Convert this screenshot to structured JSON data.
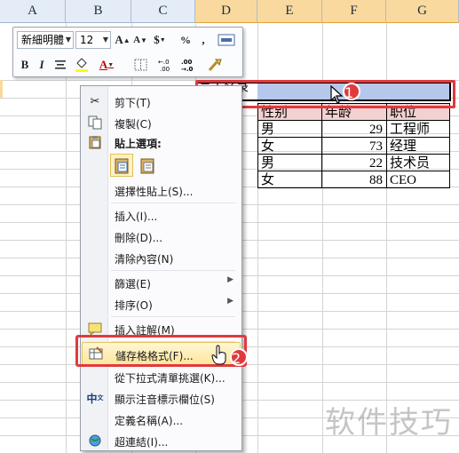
{
  "columns": [
    "A",
    "B",
    "C",
    "D",
    "E",
    "F",
    "G"
  ],
  "mini_toolbar": {
    "font_name": "新細明體",
    "font_size": "12",
    "grow_label": "A",
    "shrink_label": "A",
    "currency_label": "$",
    "percent_label": "%",
    "comma_label": ",",
    "bold_label": "B",
    "italic_label": "I",
    "font_color_label": "A"
  },
  "table": {
    "title": "员工名录",
    "headers": [
      "性别",
      "年龄",
      "职位"
    ],
    "rows": [
      {
        "gender": "男",
        "age": "29",
        "position": "工程师"
      },
      {
        "gender": "女",
        "age": "73",
        "position": "经理"
      },
      {
        "gender": "男",
        "age": "22",
        "position": "技术员"
      },
      {
        "gender": "女",
        "age": "88",
        "position": "CEO"
      }
    ]
  },
  "context_menu": {
    "cut": "剪下(T)",
    "copy": "複製(C)",
    "paste_options": "貼上選項:",
    "paste_special": "選擇性貼上(S)...",
    "insert": "插入(I)...",
    "delete": "刪除(D)...",
    "clear": "清除內容(N)",
    "filter": "篩選(E)",
    "sort": "排序(O)",
    "insert_comment": "插入註解(M)",
    "format_cells": "儲存格格式(F)...",
    "pick_list": "從下拉式清單挑選(K)...",
    "phonetic": "顯示注音標示欄位(S)",
    "define_name": "定義名稱(A)...",
    "hyperlink": "超連結(I)..."
  },
  "callouts": {
    "step1": "1",
    "step2": "2"
  },
  "watermark": "软件技巧",
  "colors": {
    "accent": "#e03a3e",
    "header_selected": "#f9d99e",
    "selection": "#b5c8ec"
  }
}
